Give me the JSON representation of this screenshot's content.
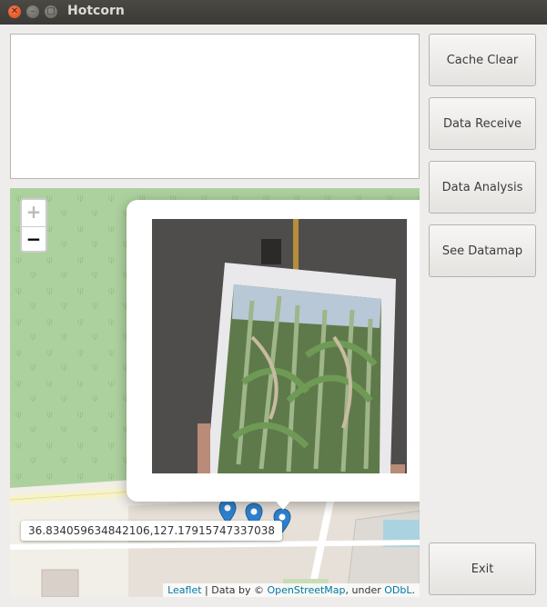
{
  "window": {
    "title": "Hotcorn"
  },
  "buttons": {
    "cache_clear": "Cache Clear",
    "data_receive": "Data Receive",
    "data_analysis": "Data Analysis",
    "see_datamap": "See Datamap",
    "exit": "Exit"
  },
  "map": {
    "zoom_in": "+",
    "zoom_out": "−",
    "coordinates": "36.834059634842106,127.17915747337038",
    "attribution": {
      "leaflet": "Leaflet",
      "sep1": " | Data by © ",
      "osm": "OpenStreetMap",
      "sep2": ", under ",
      "odbl": "ODbL",
      "end": "."
    },
    "popup_image": "corn-field-photo"
  },
  "colors": {
    "park_green": "#add19e",
    "marker_blue": "#2e81cd",
    "link": "#0078a8"
  }
}
